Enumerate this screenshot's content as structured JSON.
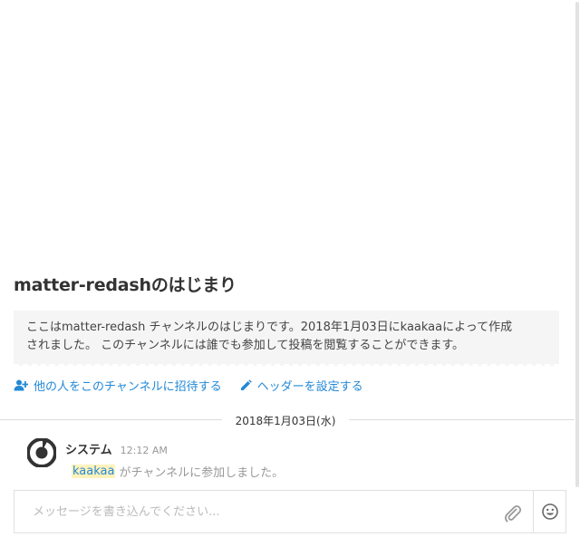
{
  "channel_intro": {
    "title": "matter-redashのはじまり",
    "description_line1": "ここはmatter-redash チャンネルのはじまりです。2018年1月03日にkaakaaによって作成",
    "description_line2": "されました。 このチャンネルには誰でも参加して投稿を閲覧することができます。",
    "invite_label": "他の人をこのチャンネルに招待する",
    "set_header_label": "ヘッダーを設定する",
    "link_color": "#2389d7"
  },
  "date_separator": "2018年1月03日(水)",
  "post": {
    "username": "システム",
    "time": "12:12 AM",
    "mention": "kaakaa",
    "message": "がチャンネルに参加しました。",
    "avatar_icon": "mattermost-logo-icon"
  },
  "composer": {
    "placeholder": "メッセージを書き込んでください...",
    "value": "",
    "attach_icon": "paperclip-icon",
    "emoji_icon": "smiley-icon"
  }
}
